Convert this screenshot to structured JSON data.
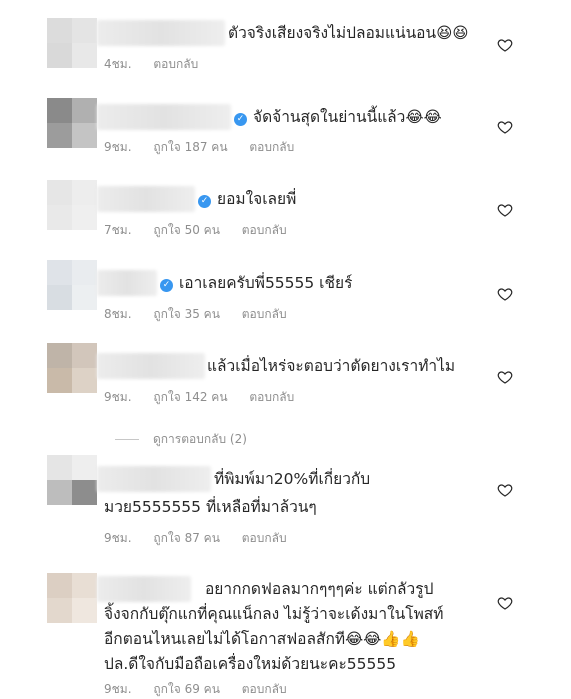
{
  "comments": [
    {
      "text": "ตัวจริงเสียงจริงไม่ปลอมแน่นอน😆😆",
      "time": "4ชม.",
      "likes": "",
      "reply": "ตอบกลับ"
    },
    {
      "text": "จัดจ้านสุดในย่านนี้แล้ว😂😂",
      "time": "9ชม.",
      "likes": "ถูกใจ 187 คน",
      "reply": "ตอบกลับ"
    },
    {
      "text": "ยอมใจเลยพี่",
      "time": "7ชม.",
      "likes": "ถูกใจ 50 คน",
      "reply": "ตอบกลับ"
    },
    {
      "text": "เอาเลยครับพี่55555 เชียร์",
      "time": "8ชม.",
      "likes": "ถูกใจ 35 คน",
      "reply": "ตอบกลับ"
    },
    {
      "text": "แล้วเมื่อไหร่จะตอบว่าตัดยางเราทำไม",
      "time": "9ชม.",
      "likes": "ถูกใจ 142 คน",
      "reply": "ตอบกลับ"
    },
    {
      "line1": "ที่พิมพ์มา20%ที่เกี่ยวกับ",
      "line2": "มวย5555555 ที่เหลือที่มาล้วนๆ",
      "time": "9ชม.",
      "likes": "ถูกใจ 87 คน",
      "reply": "ตอบกลับ"
    },
    {
      "line1": "อยากกดฟอลมากๆๆๆค่ะ แต่กลัวรูป",
      "line2": "จิ้งจกกับตุ๊กแกที่คุณแน็กลง ไม่รู้ว่าจะเด้งมาในโพสท์",
      "line3": "อีกตอนไหนเลยไม่ได้โอกาสฟอลสักที😂😂👍👍",
      "line4": "ปล.ดีใจกับมือถือเครื่องใหม่ด้วยนะคะ55555",
      "time": "9ชม.",
      "likes": "ถูกใจ 69 คน",
      "reply": "ตอบกลับ"
    }
  ],
  "view_replies": "ดูการตอบกลับ (2)",
  "icons": {
    "like": "heart-outline-icon",
    "verified": "verified-badge-icon"
  },
  "colors": {
    "meta": "#8e8e8e",
    "verified": "#3897f0",
    "text": "#262626"
  }
}
